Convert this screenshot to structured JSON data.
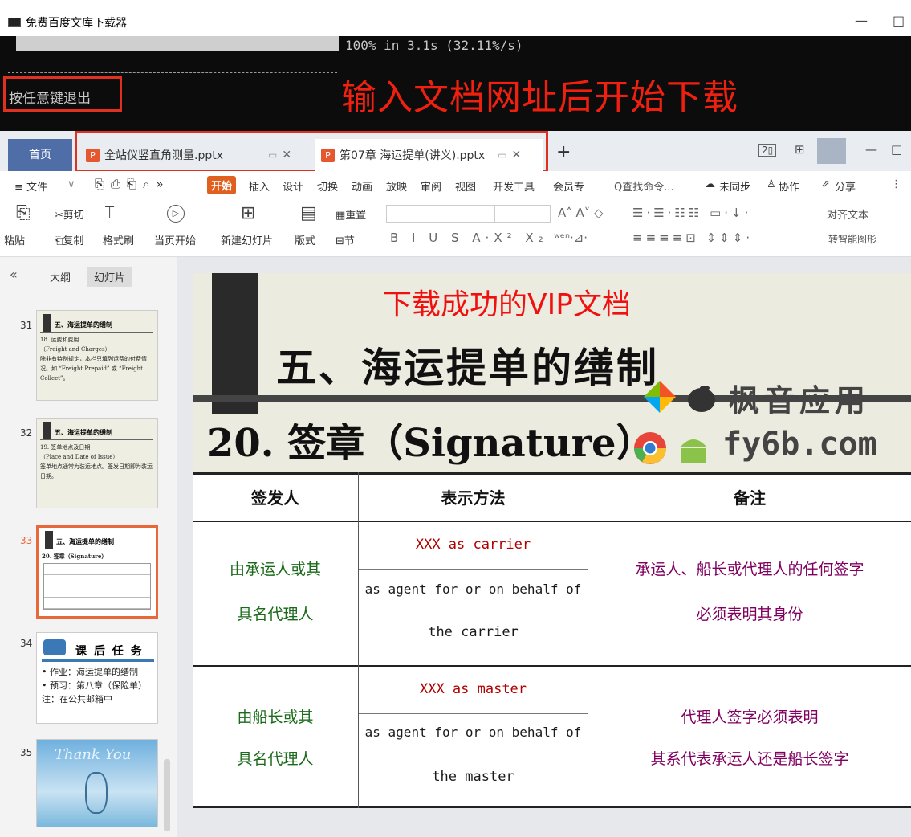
{
  "console_window": {
    "title": "免费百度文库下载器",
    "minimize": "—",
    "maximize": "□",
    "progress_text": "100% in 3.1s (32.11%/s)",
    "progress_fraction": 1.0,
    "exit_prompt": "按任意键退出",
    "annotation": "输入文档网址后开始下载"
  },
  "wps": {
    "tabs": {
      "home": "首页",
      "doc1": "全站仪竖直角测量.pptx",
      "doc2": "第07章 海运提单(讲义).pptx",
      "add": "+",
      "close": "✕"
    },
    "menu": {
      "file": "≡ 文件",
      "items": [
        "开始",
        "插入",
        "设计",
        "切换",
        "动画",
        "放映",
        "审阅",
        "视图",
        "开发工具",
        "会员专"
      ],
      "search": "Q查找命令...",
      "sync": "未同步",
      "collab": "协作",
      "share": "分享"
    },
    "ribbon": {
      "paste": "粘贴",
      "cut": "剪切",
      "copy": "复制",
      "format_painter": "格式刷",
      "play": "当页开始",
      "new_slide": "新建幻灯片",
      "layout": "版式",
      "section": "节",
      "reset": "重置",
      "align_text": "对齐文本",
      "smart_shape": "转智能图形"
    },
    "left_panel": {
      "collapse": "«",
      "tab_outline": "大纲",
      "tab_slides": "幻灯片",
      "thumbs": [
        {
          "num": "31",
          "title": "五、海运提单的缮制",
          "body": "18. 运费和费用\n（Freight and Charges）\n除非有特别规定，本栏只填列运费的付费情况。如 “Freight Prepaid” 或 “Freight Collect”。"
        },
        {
          "num": "32",
          "title": "五、海运提单的缮制",
          "body": "19. 签单地点及日期\n（Place and Date of Issue）\n签单地点通常为装运地点。签发日期即为装运日期。"
        },
        {
          "num": "33",
          "title": "五、海运提单的缮制",
          "body": "20. 签章（Signature）"
        },
        {
          "num": "34",
          "title": "课 后 任 务",
          "body": "• 作业：海运提单的缮制\n• 预习：第八章（保险单）\n注：在公共邮箱中"
        },
        {
          "num": "35",
          "title": "Thank You",
          "body": ""
        }
      ]
    },
    "slide": {
      "vip_annotation": "下载成功的VIP文档",
      "title": "五、海运提单的缮制",
      "subtitle": "20. 签章（Signature）",
      "watermark_cn": "枫音应用",
      "watermark_url": "fy6b.com",
      "table": {
        "headers": [
          "签发人",
          "表示方法",
          "备注"
        ],
        "rows": [
          {
            "issuer": "由承运人或其具名代理人",
            "method1": "XXX as carrier",
            "method2": "as agent for or on behalf of the carrier",
            "note": "承运人、船长或代理人的任何签字必须表明其身份"
          },
          {
            "issuer": "由船长或其具名代理人",
            "method1": "XXX as master",
            "method2": "as agent for or on behalf of the master",
            "note": "代理人签字必须表明其系代表承运人还是船长签字"
          }
        ],
        "cells": {
          "r1_issuer_a": "由承运人或其",
          "r1_issuer_b": "具名代理人",
          "r1_method2_a": "as agent for or on behalf of",
          "r1_method2_b": "the carrier",
          "r1_note_a": "承运人、船长或代理人的任何签字",
          "r1_note_b": "必须表明其身份",
          "r2_issuer_a": "由船长或其",
          "r2_issuer_b": "具名代理人",
          "r2_method2_a": "as agent for or on behalf of",
          "r2_method2_b": "the master",
          "r2_note_a": "代理人签字必须表明",
          "r2_note_b": "其系代表承运人还是船长签字"
        }
      }
    }
  },
  "colors": {
    "console_bg": "#0c0c0c",
    "annotation_red": "#f02010",
    "wps_home": "#4f6ea8",
    "start_tab": "#e06020",
    "selected_thumb": "#e8683c"
  }
}
